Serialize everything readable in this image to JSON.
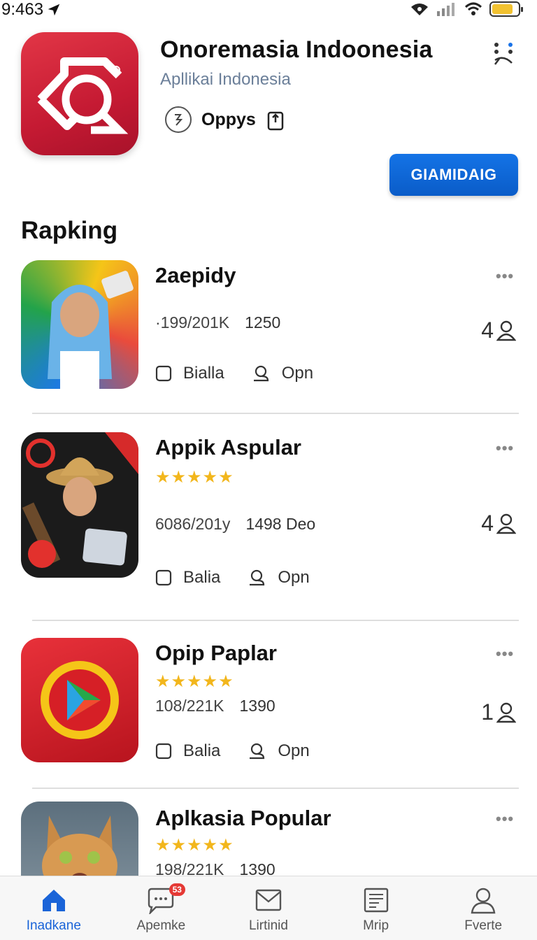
{
  "status": {
    "time": "9:463"
  },
  "app": {
    "title": "Onoremasia Indoonesia",
    "subtitle": "Apllikai Indonesia",
    "developer": "Oppys",
    "get_label": "GIAMIDAIG"
  },
  "section": {
    "title": "Rapking"
  },
  "items": [
    {
      "name": "2aepidy",
      "stars": "",
      "stat1": "·199/201K",
      "stat2": "1250",
      "count": "4",
      "action1": "Bialla",
      "action2": "Opn"
    },
    {
      "name": "Appik Aspular",
      "stars": "★★★★★",
      "stat1": "6086/201y",
      "stat2": "1498 Deo",
      "count": "4",
      "action1": "Balia",
      "action2": "Opn"
    },
    {
      "name": "Opip Paplar",
      "stars": "★★★★★",
      "stat1": "108/221K",
      "stat2": "1390",
      "count": "1",
      "action1": "Balia",
      "action2": "Opn"
    },
    {
      "name": "Aplkasia Popular",
      "stars": "★★★★★",
      "stat1": "198/221K",
      "stat2": "1390",
      "count": "",
      "action1": "",
      "action2": ""
    }
  ],
  "more_label": "•••",
  "tabs": [
    {
      "label": "Inadkane",
      "icon": "home-icon",
      "active": true
    },
    {
      "label": "Apemke",
      "icon": "chat-icon",
      "badge": "53"
    },
    {
      "label": "Lirtinid",
      "icon": "mail-icon"
    },
    {
      "label": "Mrip",
      "icon": "document-icon"
    },
    {
      "label": "Fverte",
      "icon": "profile-icon"
    }
  ],
  "colors": {
    "accent": "#0a5cc8",
    "brand_red": "#c51a33",
    "star": "#f2b61c",
    "subtitle": "#6b7f99"
  }
}
